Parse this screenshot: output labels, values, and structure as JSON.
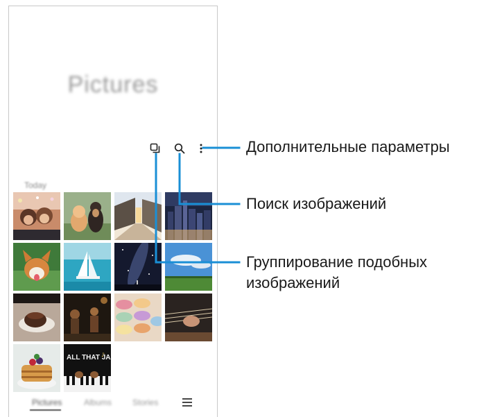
{
  "screen": {
    "title": "Pictures",
    "section_label": "Today"
  },
  "toolbar": {
    "group_icon": "group-similar-icon",
    "search_icon": "search-icon",
    "more_icon": "more-options-icon"
  },
  "tabs": {
    "items": [
      "Pictures",
      "Albums",
      "Stories"
    ],
    "active_index": 0,
    "menu_icon": "hamburger-menu-icon"
  },
  "callouts": {
    "more_options": "Дополнительные параметры",
    "search": "Поиск изображений",
    "group_line1": "Группирование подобных",
    "group_line2": "изображений"
  },
  "thumbnails": [
    {
      "name": "photo-friends-selfie"
    },
    {
      "name": "photo-cat-and-dog"
    },
    {
      "name": "photo-village-street"
    },
    {
      "name": "photo-city-night"
    },
    {
      "name": "photo-corgi"
    },
    {
      "name": "photo-sailboat"
    },
    {
      "name": "photo-milky-way"
    },
    {
      "name": "photo-field-sky"
    },
    {
      "name": "photo-chocolate-cake"
    },
    {
      "name": "photo-concert"
    },
    {
      "name": "photo-macarons"
    },
    {
      "name": "photo-guitar"
    },
    {
      "name": "photo-pancakes"
    },
    {
      "name": "photo-jazz-poster",
      "caption": "ALL THAT JAZZ"
    }
  ],
  "colors": {
    "accent_line": "#1a8fd6"
  }
}
